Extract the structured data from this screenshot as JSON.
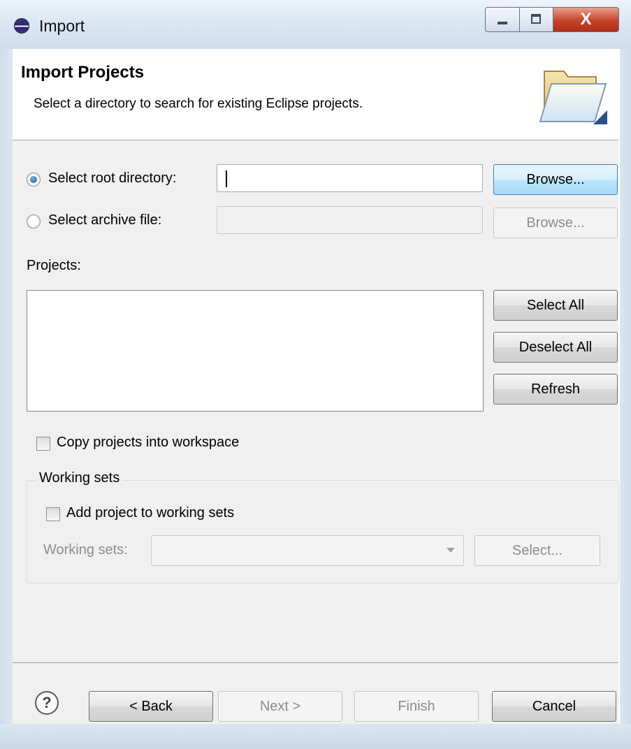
{
  "window": {
    "title": "Import",
    "close_glyph": "X"
  },
  "banner": {
    "title": "Import Projects",
    "description": "Select a directory to search for existing Eclipse projects.",
    "icon": "open-folder-icon"
  },
  "source": {
    "root_directory": {
      "label": "Select root directory:",
      "value": "",
      "selected": true,
      "browse_label": "Browse..."
    },
    "archive_file": {
      "label": "Select archive file:",
      "value": "",
      "selected": false,
      "browse_label": "Browse..."
    }
  },
  "projects": {
    "label": "Projects:",
    "items": [],
    "select_all_label": "Select All",
    "deselect_all_label": "Deselect All",
    "refresh_label": "Refresh"
  },
  "options": {
    "copy_label": "Copy projects into workspace",
    "copy_checked": false
  },
  "working_sets": {
    "legend": "Working sets",
    "add_label": "Add project to working sets",
    "add_checked": false,
    "combo_label": "Working sets:",
    "combo_value": "",
    "select_label": "Select..."
  },
  "footer": {
    "help_glyph": "?",
    "back_label": "< Back",
    "next_label": "Next >",
    "finish_label": "Finish",
    "cancel_label": "Cancel"
  },
  "colors": {
    "accent": "#3c7fb1",
    "close_button": "#c7432a",
    "dialog_bg": "#f0f0f0"
  }
}
